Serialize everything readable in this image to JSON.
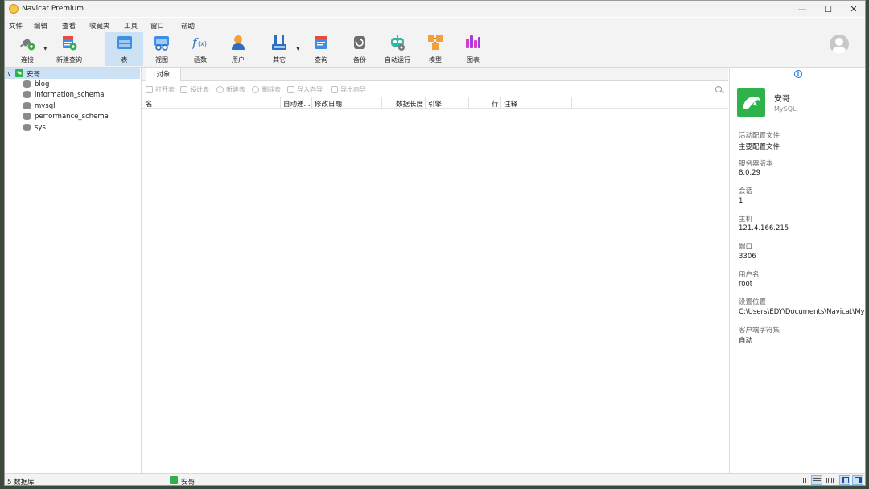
{
  "window": {
    "title": "Navicat Premium"
  },
  "menubar": [
    "文件",
    "编辑",
    "查看",
    "收藏夹",
    "工具",
    "窗口",
    "帮助"
  ],
  "toolbar": {
    "connect": "连接",
    "new_query": "新建查询",
    "table": "表",
    "view": "视图",
    "function": "函数",
    "user": "用户",
    "other": "其它",
    "query": "查询",
    "backup": "备份",
    "automation": "自动运行",
    "model": "模型",
    "chart": "图表"
  },
  "sidebar": {
    "connection": "安哥",
    "databases": [
      "blog",
      "information_schema",
      "mysql",
      "performance_schema",
      "sys"
    ]
  },
  "main": {
    "tab": "对象",
    "object_toolbar": [
      "打开表",
      "设计表",
      "新建表",
      "删除表",
      "导入向导",
      "导出向导"
    ],
    "columns": [
      "名",
      "自动递...",
      "修改日期",
      "数据长度",
      "引擎",
      "行",
      "注释"
    ]
  },
  "info": {
    "name": "安哥",
    "type": "MySQL",
    "fields": [
      {
        "label": "活动配置文件",
        "value": "主要配置文件"
      },
      {
        "label": "服务器版本",
        "value": "8.0.29"
      },
      {
        "label": "会话",
        "value": "1"
      },
      {
        "label": "主机",
        "value": "121.4.166.215"
      },
      {
        "label": "端口",
        "value": "3306"
      },
      {
        "label": "用户名",
        "value": "root"
      },
      {
        "label": "设置位置",
        "value": "C:\\Users\\EDY\\Documents\\Navicat\\MyS"
      },
      {
        "label": "客户端字符集",
        "value": "自动"
      }
    ]
  },
  "statusbar": {
    "db_count": "5 数据库",
    "connection": "安哥"
  },
  "colors": {
    "selection": "#cde1f5",
    "mysql_green": "#2db34a",
    "accent_blue": "#1a73d9"
  }
}
